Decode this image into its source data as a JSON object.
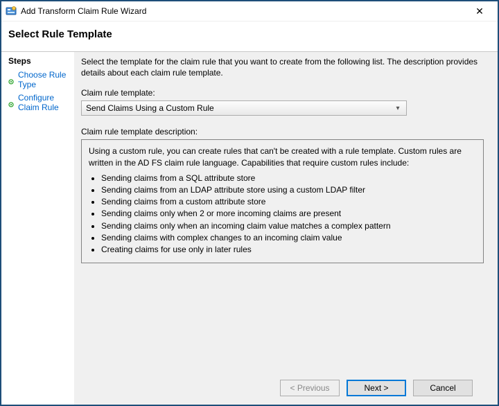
{
  "window": {
    "title": "Add Transform Claim Rule Wizard",
    "close_glyph": "✕"
  },
  "header": {
    "title": "Select Rule Template"
  },
  "sidebar": {
    "title": "Steps",
    "items": [
      {
        "label": "Choose Rule Type"
      },
      {
        "label": "Configure Claim Rule"
      }
    ]
  },
  "main": {
    "instruction": "Select the template for the claim rule that you want to create from the following list. The description provides details about each claim rule template.",
    "select_label": "Claim rule template:",
    "selected_option": "Send Claims Using a Custom Rule",
    "desc_label": "Claim rule template description:",
    "desc_intro": "Using a custom rule, you can create rules that can't be created with a rule template.  Custom rules are written in the AD FS claim rule language.  Capabilities that require custom rules include:",
    "desc_bullets": [
      "Sending claims from a SQL attribute store",
      "Sending claims from an LDAP attribute store using a custom LDAP filter",
      "Sending claims from a custom attribute store",
      "Sending claims only when 2 or more incoming claims are present",
      "Sending claims only when an incoming claim value matches a complex pattern",
      "Sending claims with complex changes to an incoming claim value",
      "Creating claims for use only in later rules"
    ]
  },
  "buttons": {
    "previous": "< Previous",
    "next": "Next >",
    "cancel": "Cancel"
  }
}
